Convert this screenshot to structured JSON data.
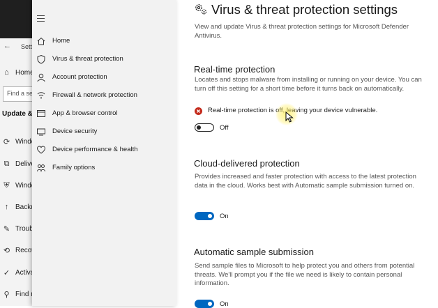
{
  "background_window": {
    "title_fragment": "Setti",
    "nav": [
      {
        "icon": "home-icon",
        "label": "Home"
      },
      {
        "icon": "sync-icon",
        "label": "Windows Update"
      },
      {
        "icon": "delivery-icon",
        "label": "Delivery Optimization"
      },
      {
        "icon": "shield-icon",
        "label": "Windows Security"
      },
      {
        "icon": "backup-icon",
        "label": "Backup"
      },
      {
        "icon": "wrench-icon",
        "label": "Troubleshoot"
      },
      {
        "icon": "recovery-icon",
        "label": "Recovery"
      },
      {
        "icon": "activation-icon",
        "label": "Activation"
      },
      {
        "icon": "find-device-icon",
        "label": "Find my device"
      }
    ],
    "search_placeholder": "Find a setting",
    "section": "Update & Security"
  },
  "sidebar": {
    "items": [
      {
        "icon": "home-icon",
        "label": "Home"
      },
      {
        "icon": "shield-icon",
        "label": "Virus & threat protection"
      },
      {
        "icon": "person-icon",
        "label": "Account protection"
      },
      {
        "icon": "wifi-icon",
        "label": "Firewall & network protection"
      },
      {
        "icon": "app-browser-icon",
        "label": "App & browser control"
      },
      {
        "icon": "device-security-icon",
        "label": "Device security"
      },
      {
        "icon": "heart-icon",
        "label": "Device performance & health"
      },
      {
        "icon": "family-icon",
        "label": "Family options"
      }
    ]
  },
  "page": {
    "title": "Virus & threat protection settings",
    "description": "View and update Virus & threat protection settings for Microsoft Defender Antivirus."
  },
  "sections": {
    "realtime": {
      "heading": "Real-time protection",
      "description": "Locates and stops malware from installing or running on your device. You can turn off this setting for a short time before it turns back on automatically.",
      "warning": "Real-time protection is off, leaving your device vulnerable.",
      "toggle_state": "Off"
    },
    "cloud": {
      "heading": "Cloud-delivered protection",
      "description": "Provides increased and faster protection with access to the latest protection data in the cloud. Works best with Automatic sample submission turned on.",
      "toggle_state": "On"
    },
    "sample": {
      "heading": "Automatic sample submission",
      "description": "Send sample files to Microsoft to help protect you and others from potential threats. We'll prompt you if the file we need is likely to contain personal information.",
      "toggle_state": "On"
    }
  },
  "colors": {
    "accent": "#0067c0",
    "error": "#c42b1c",
    "sidebar_bg": "#f2f2f2"
  }
}
